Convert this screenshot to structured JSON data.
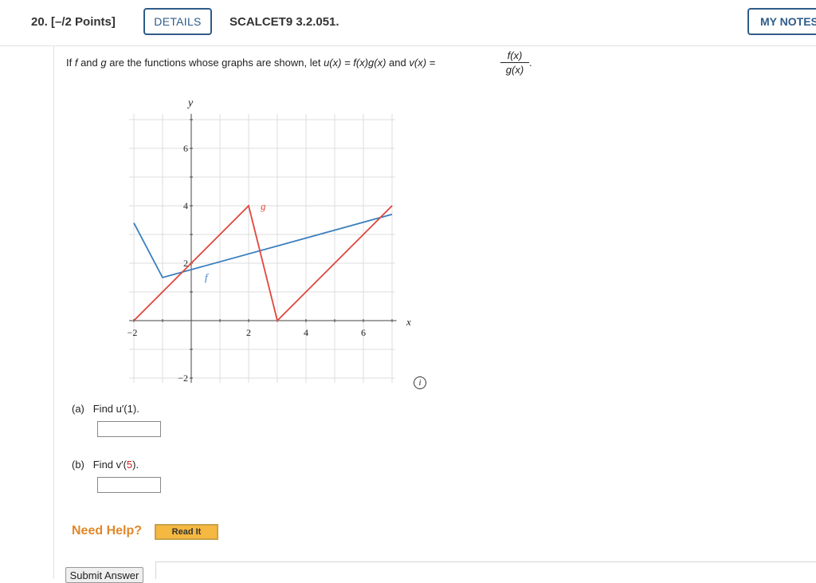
{
  "header": {
    "question_number": "20.",
    "points": "[–/2 Points]",
    "details_label": "DETAILS",
    "question_code": "SCALCET9 3.2.051.",
    "my_notes_label": "MY NOTES"
  },
  "prompt": {
    "part1": "If ",
    "f": "f",
    "and": " and ",
    "g": "g",
    "part2": " are the functions whose graphs are shown, let ",
    "u_def": "u(x) = f(x)g(x)",
    "and2": " and ",
    "v_def": "v(x) =",
    "frac_num": "f(x)",
    "frac_den": "g(x)",
    "end": "."
  },
  "chart_data": {
    "type": "line",
    "xlabel": "x",
    "ylabel": "y",
    "xlim": [
      -2,
      7.1
    ],
    "ylim": [
      -2,
      7.2
    ],
    "x_ticks": [
      "−2",
      "2",
      "4",
      "6"
    ],
    "y_ticks": [
      "−2",
      "2",
      "4",
      "6"
    ],
    "grid": true,
    "series": [
      {
        "name": "f",
        "color": "#3a7ebf",
        "points": [
          [
            -2,
            3.4
          ],
          [
            -1,
            1.5
          ],
          [
            7,
            3.7
          ]
        ]
      },
      {
        "name": "g",
        "color": "#e0463c",
        "points": [
          [
            -2,
            0
          ],
          [
            2,
            4
          ],
          [
            3,
            0
          ],
          [
            7,
            4
          ]
        ]
      }
    ]
  },
  "part_a": {
    "label": "(a)",
    "text": "Find u′(1)."
  },
  "part_b": {
    "label": "(b)",
    "text_before": "Find v′(",
    "value": "5",
    "text_after": ")."
  },
  "help": {
    "label": "Need Help?",
    "read_it": "Read It"
  },
  "submit_label": "Submit Answer"
}
